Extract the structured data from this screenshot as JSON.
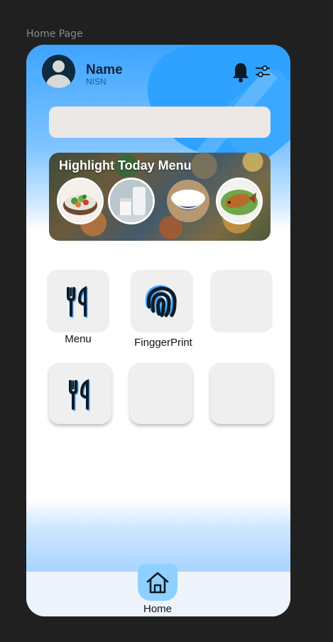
{
  "frame": {
    "label": "Home Page"
  },
  "header": {
    "user_name": "Name",
    "user_id": "NISN",
    "notification_icon": "bell-icon",
    "filter_icon": "sliders-icon"
  },
  "search": {
    "placeholder": "",
    "value": ""
  },
  "banner": {
    "title": "Highlight Today Menu",
    "dishes": [
      "salad",
      "milk",
      "rice",
      "grilled-fish"
    ]
  },
  "grid": {
    "row1": [
      {
        "label": "Menu",
        "icon": "fork-knife-icon"
      },
      {
        "label": "FinggerPrint",
        "icon": "fingerprint-icon"
      },
      {
        "label": "",
        "icon": ""
      }
    ],
    "row2": [
      {
        "label": "",
        "icon": "fork-knife-icon"
      },
      {
        "label": "",
        "icon": ""
      },
      {
        "label": "",
        "icon": ""
      }
    ]
  },
  "nav": {
    "home_label": "Home",
    "home_icon": "home-icon"
  },
  "colors": {
    "accent": "#3ea4ff",
    "dark": "#10243a",
    "nav_active": "#8ed0ff"
  }
}
